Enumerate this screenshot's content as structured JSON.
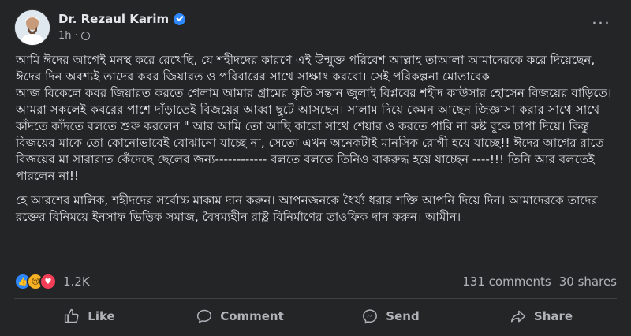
{
  "post": {
    "author": "Dr. Rezaul Karim",
    "time": "1h",
    "paragraphs": [
      "আমি ঈদের আগেই মনস্থ করে রেখেছি, যে শহীদদের কারণে এই উন্মুক্ত পরিবেশ আল্লাহ তাআলা আমাদেরকে করে দিয়েছেন, ঈদের দিন অবশ্যই তাদের কবর জিয়ারত ও পরিবারের সাথে সাক্ষাৎ করবো। সেই পরিকল্পনা মোতাবেক\nআজ বিকেলে কবর জিয়ারত করতে গেলাম আমার গ্রামের কৃতি সন্তান জুলাই বিপ্লবের শহীদ কাউসার হোসেন বিজয়ের বাড়িতে। আমরা সকলেই কবরের পাশে দাঁড়াতেই বিজয়ের আব্বা ছুটে আসছেন। সালাম দিয়ে কেমন আছেন জিজ্ঞাসা করার সাথে সাথে কাঁদতে কাঁদতে বলতে শুরু করলেন \" আর আমি তো আছি কারো সাথে শেয়ার ও করতে পারি না কষ্ট বুকে চাপা দিয়ে। কিন্তু বিজয়ের মাকে তো কোনোভাবেই বোঝানো যাচ্ছে না, সেতো এখন অনেকটাই মানসিক রোগী হয়ে যাচ্ছে!! ঈদের আগের রাতে বিজয়ের মা সারারাত কেঁদেছে ছেলের জন্য------------ বলতে বলতে তিনিও বাকরুদ্ধ হয়ে যাচ্ছেন ----!!! তিনি আর বলতেই পারলেন না!!",
      "হে আরশের মালিক, শহীদদের সর্বোচ্চ মাকাম দান করুন। আপনজনকে ধৈর্য্য ধরার শক্তি আপনি দিয়ে দিন। আমাদেরকে তাদের রক্তের বিনিময়ে ইনসাফ ভিত্তিক সমাজ, বৈষম্যহীন রাষ্ট্র বিনির্মাণের তাওফিক দান করুন। আমীন।"
    ]
  },
  "stats": {
    "reaction_count": "1.2K",
    "comments": "131 comments",
    "shares": "30 shares"
  },
  "actions": {
    "like": "Like",
    "comment": "Comment",
    "send": "Send",
    "share": "Share"
  },
  "icons": {
    "reactions": [
      "like-icon",
      "sad-icon",
      "love-icon"
    ],
    "colors": {
      "like": "#2d88ff",
      "sad": "#f7b125",
      "love": "#f33e58",
      "verified": "#2d88ff"
    }
  }
}
